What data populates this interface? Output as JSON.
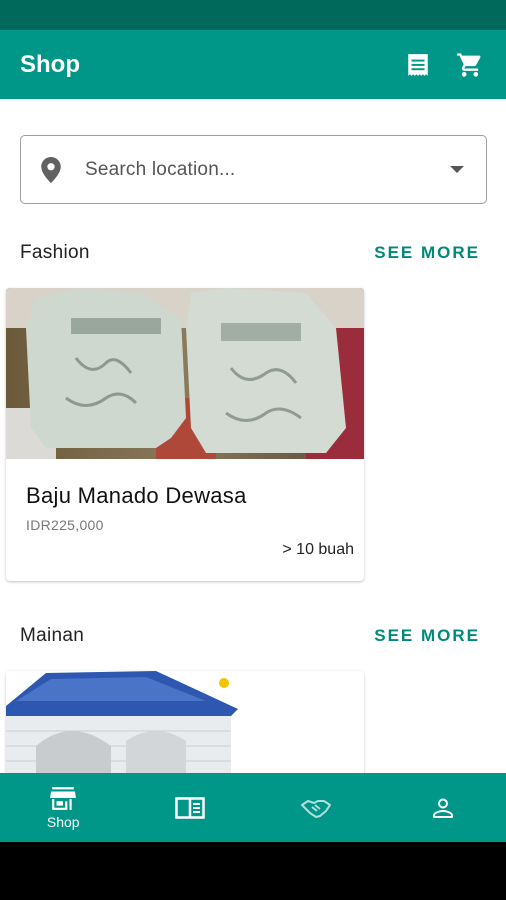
{
  "app_bar": {
    "title": "Shop",
    "icons": [
      "receipt-icon",
      "cart-icon"
    ]
  },
  "search": {
    "placeholder": "Search location..."
  },
  "sections": [
    {
      "title": "Fashion",
      "see_more": "SEE MORE",
      "products": [
        {
          "name": "Baju Manado Dewasa",
          "price": "IDR225,000",
          "stock": "> 10 buah"
        }
      ]
    },
    {
      "title": "Mainan",
      "see_more": "SEE MORE"
    }
  ],
  "bottom_nav": {
    "items": [
      {
        "label": "Shop",
        "icon": "store-icon",
        "active": true
      },
      {
        "label": "",
        "icon": "catalog-icon"
      },
      {
        "label": "",
        "icon": "handshake-icon"
      },
      {
        "label": "",
        "icon": "account-icon"
      }
    ]
  },
  "colors": {
    "primary": "#009688",
    "primary_dark": "#00695c",
    "accent_text": "#00897b"
  }
}
